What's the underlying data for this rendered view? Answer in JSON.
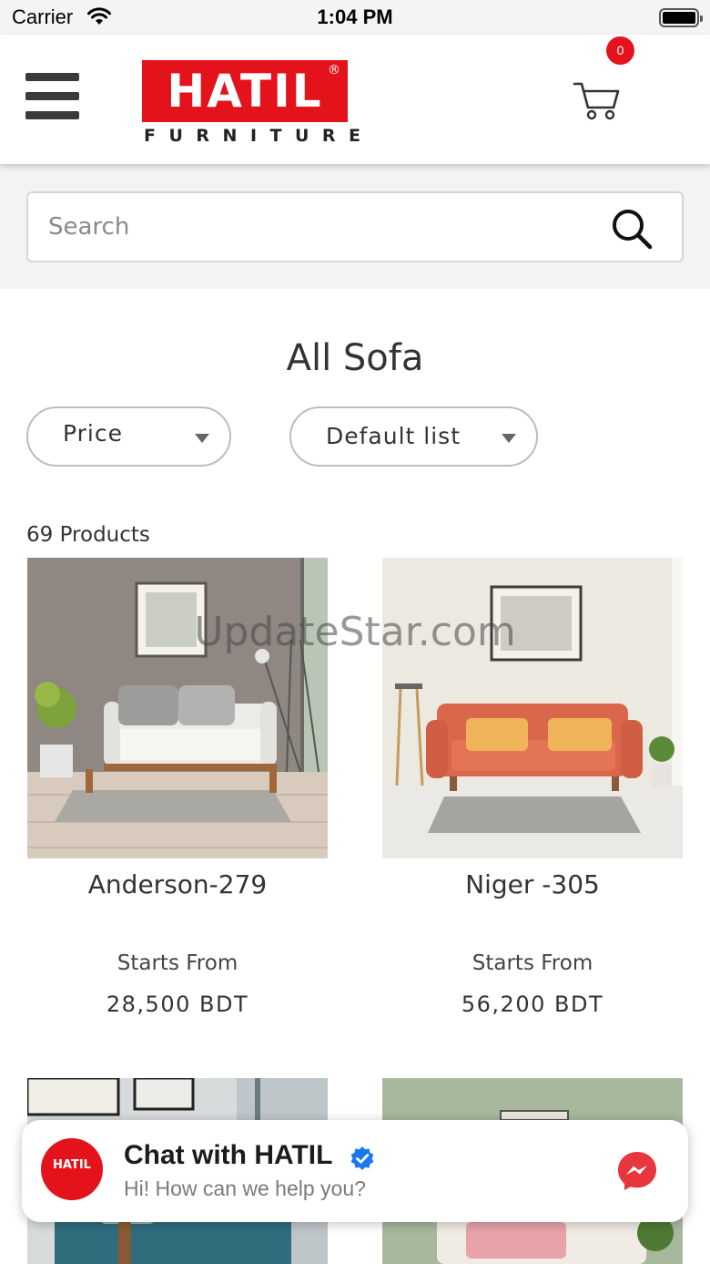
{
  "status_bar": {
    "carrier": "Carrier",
    "time": "1:04 PM"
  },
  "header": {
    "logo_text": "HATIL",
    "logo_registered": "®",
    "logo_subtitle": "FURNITURE",
    "cart_count": "0"
  },
  "search": {
    "placeholder": "Search",
    "value": ""
  },
  "page_title": "All Sofa",
  "filters": {
    "price_label": "Price",
    "sort_label": "Default list"
  },
  "product_count": "69 Products",
  "products": [
    {
      "name": "Anderson-279",
      "starts_from": "Starts From",
      "price": "28,500 BDT"
    },
    {
      "name": "Niger -305",
      "starts_from": "Starts From",
      "price": "56,200 BDT"
    }
  ],
  "watermark": "UpdateStar.com",
  "chat": {
    "title": "Chat with HATIL",
    "subtitle": "Hi! How can we help you?",
    "avatar_text": "HATIL"
  },
  "colors": {
    "brand_red": "#e3121b",
    "messenger_red": "#e8373c",
    "verified_blue": "#1877f2"
  }
}
